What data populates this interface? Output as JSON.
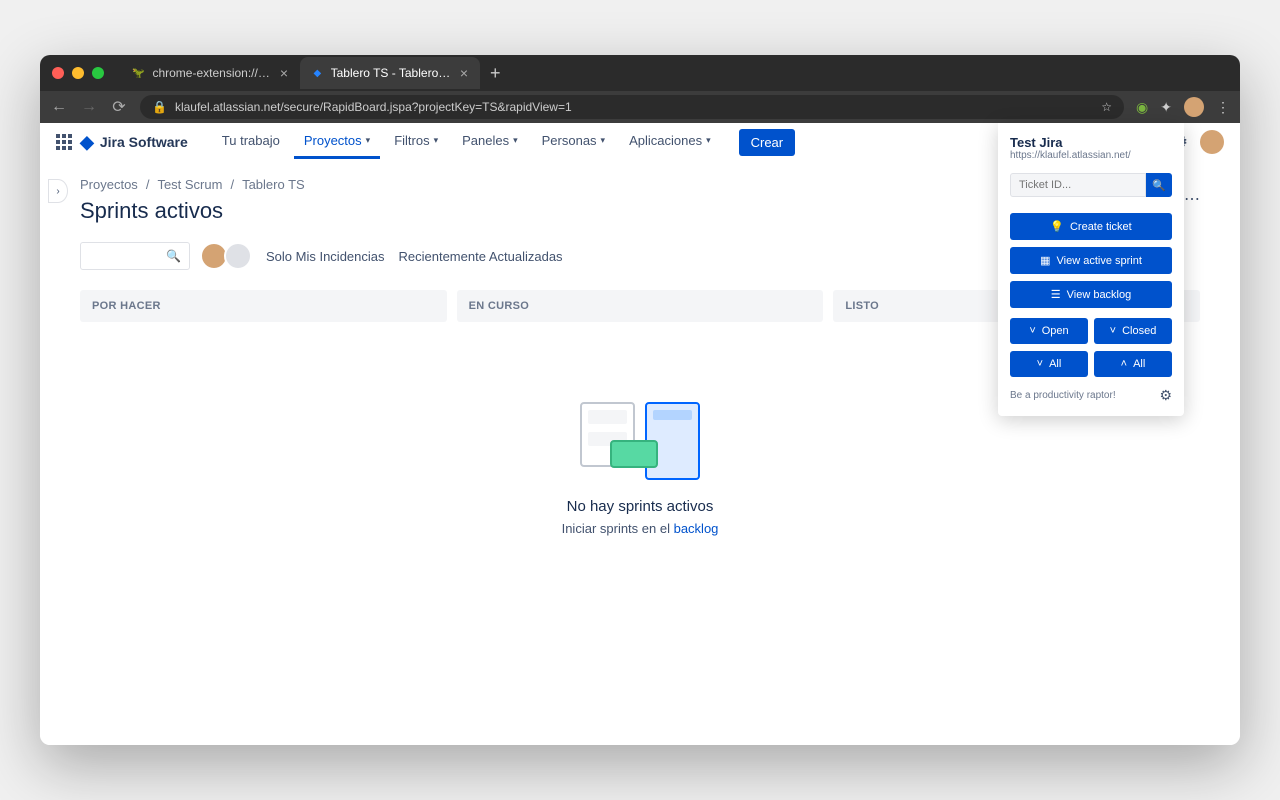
{
  "browser": {
    "tabs": [
      {
        "label": "chrome-extension://jdiffpfffme",
        "favicon": "🦖",
        "active": false
      },
      {
        "label": "Tablero TS - Tablero ágil - Jira",
        "favicon": "◆",
        "active": true
      }
    ],
    "url": "klaufel.atlassian.net/secure/RapidBoard.jspa?projectKey=TS&rapidView=1"
  },
  "jira": {
    "product": "Jira Software",
    "nav": {
      "tu_trabajo": "Tu trabajo",
      "proyectos": "Proyectos",
      "filtros": "Filtros",
      "paneles": "Paneles",
      "personas": "Personas",
      "aplicaciones": "Aplicaciones"
    },
    "crear": "Crear",
    "breadcrumbs": {
      "proyectos": "Proyectos",
      "project": "Test Scrum",
      "board": "Tablero TS"
    },
    "page_title": "Sprints activos",
    "filters": {
      "mine": "Solo Mis Incidencias",
      "recent": "Recientemente Actualizadas"
    },
    "columns": {
      "todo": "POR HACER",
      "progress": "EN CURSO",
      "done": "LISTO"
    },
    "empty": {
      "title": "No hay sprints activos",
      "sub_prefix": "Iniciar sprints en el ",
      "link": "backlog"
    }
  },
  "ext": {
    "title": "Test Jira",
    "url": "https://klaufel.atlassian.net/",
    "search_placeholder": "Ticket ID...",
    "create": "Create ticket",
    "view_sprint": "View active sprint",
    "view_backlog": "View backlog",
    "open": "Open",
    "closed": "Closed",
    "all": "All",
    "footer": "Be a productivity raptor!"
  }
}
